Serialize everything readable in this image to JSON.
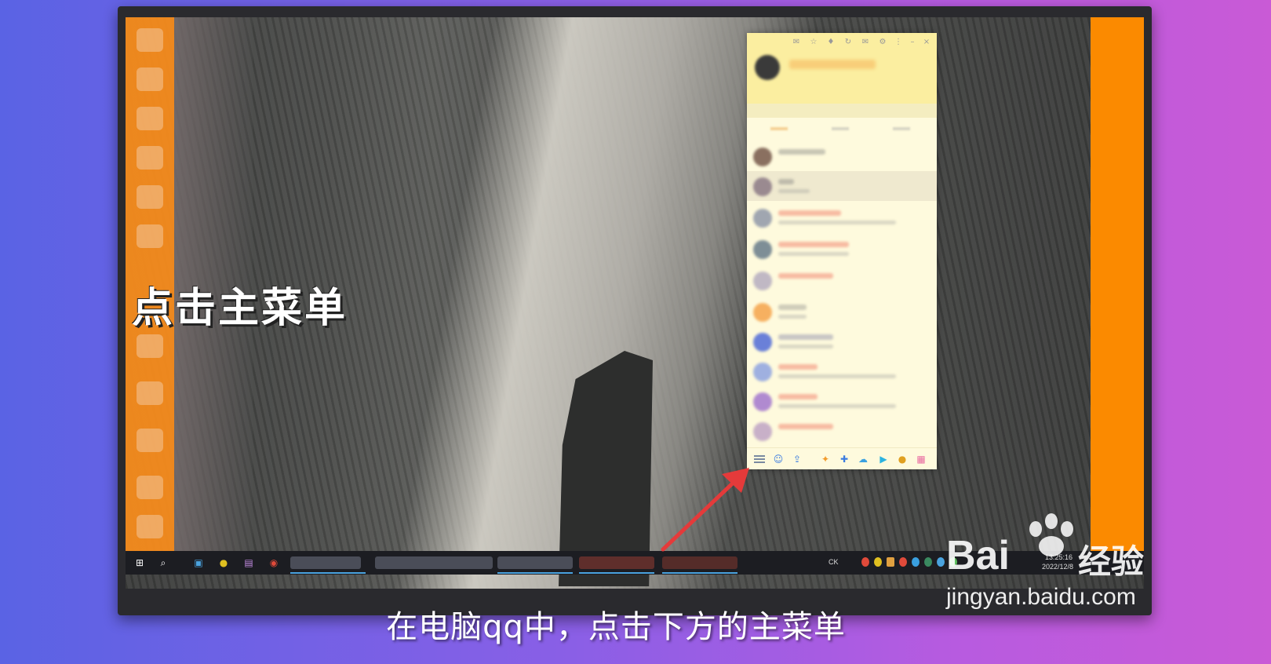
{
  "overlay": {
    "title": "点击主菜单",
    "caption": "在电脑qq中，点击下方的主菜单"
  },
  "watermark": {
    "brand": "Bai",
    "brand_suffix": "经验",
    "url": "jingyan.baidu.com"
  },
  "taskbar": {
    "start_icon": "windows-icon",
    "search_icon": "search-icon",
    "pinned": [
      "photos-icon",
      "qq-browser-icon",
      "premiere-icon",
      "chrome-icon"
    ],
    "tray_lang": "CK",
    "clock_time": "13:25:16",
    "clock_date": "2022/12/8"
  },
  "qq": {
    "bottom_bar_icons": [
      "main-menu-icon",
      "contacts-icon",
      "upload-icon",
      "game-icon",
      "gamepad-icon",
      "cloud-icon",
      "video-icon",
      "qq-browser-icon",
      "apps-grid-icon"
    ]
  },
  "colors": {
    "accent_orange": "#fb8a00",
    "qq_panel": "#fefadd",
    "arrow_red": "#e53a3a"
  }
}
